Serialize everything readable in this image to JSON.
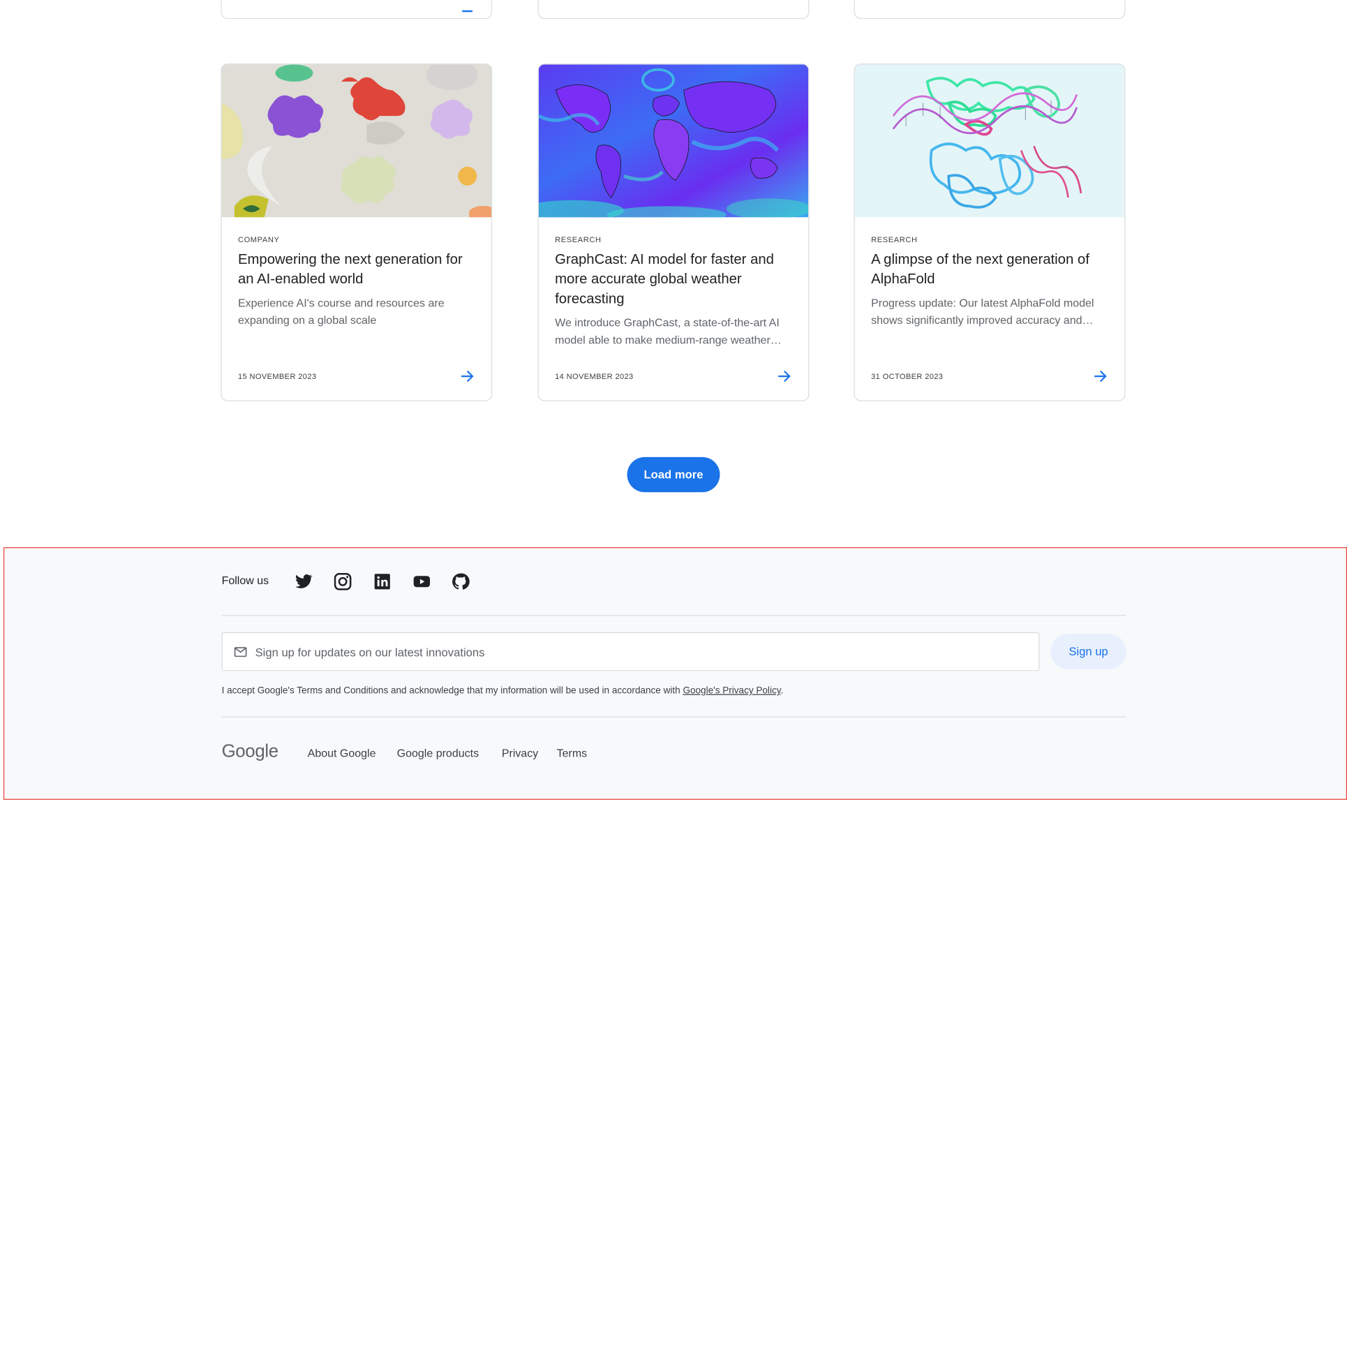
{
  "top_cards_partial": [
    "",
    "",
    ""
  ],
  "cards": [
    {
      "category": "COMPANY",
      "title": "Empowering the next generation for an AI-enabled world",
      "description": "Experience AI's course and resources are expanding on a global scale",
      "date": "15 NOVEMBER 2023",
      "image": "colorful-abstract-shapes-image"
    },
    {
      "category": "RESEARCH",
      "title": "GraphCast: AI model for faster and more accurate global weather forecasting",
      "description": "We introduce GraphCast, a state-of-the-art AI model able to make medium-range weather forecasts with unprecedented accuracy",
      "date": "14 NOVEMBER 2023",
      "image": "global-weather-map-image"
    },
    {
      "category": "RESEARCH",
      "title": "A glimpse of the next generation of AlphaFold",
      "description": "Progress update: Our latest AlphaFold model shows significantly improved accuracy and expands coverage beyond proteins",
      "date": "31 OCTOBER 2023",
      "image": "protein-dna-structure-image"
    }
  ],
  "load_more_label": "Load more",
  "footer": {
    "follow_label": "Follow us",
    "social_icons": [
      "twitter-icon",
      "instagram-icon",
      "linkedin-icon",
      "youtube-icon",
      "github-icon"
    ],
    "email_placeholder": "Sign up for updates on our latest innovations",
    "signup_label": "Sign up",
    "terms_text": "I accept Google's Terms and Conditions and acknowledge that my information will be used in accordance with ",
    "privacy_link": "Google's Privacy Policy",
    "terms_end": ".",
    "logo_text": "Google",
    "links": [
      "About Google",
      "Google products",
      "Privacy",
      "Terms"
    ]
  },
  "colors": {
    "accent": "#1a73e8",
    "footer_bg": "#f8f9fa",
    "highlight_border": "#ea4335"
  }
}
